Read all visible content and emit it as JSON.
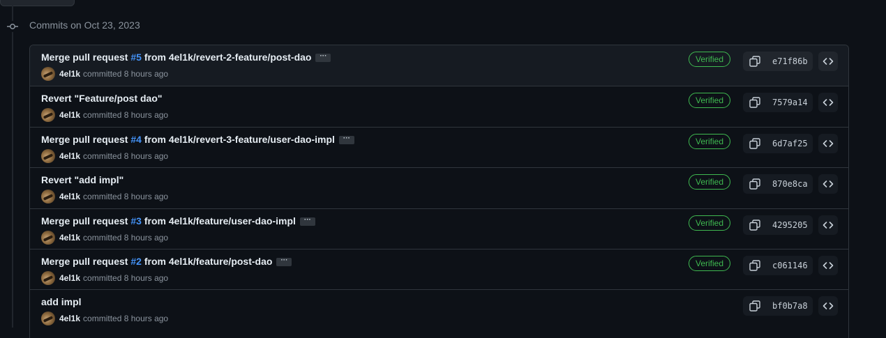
{
  "group": {
    "title": "Commits on Oct 23, 2023"
  },
  "commits": [
    {
      "prefix": "Merge pull request ",
      "pr": "#5",
      "suffix": " from 4el1k/revert-2-feature/post-dao",
      "ellipsis": "···",
      "author": "4el1k",
      "committed": "committed 8 hours ago",
      "verified": "Verified",
      "sha": "e71f86b"
    },
    {
      "prefix": "Revert \"Feature/post dao\"",
      "pr": "",
      "suffix": "",
      "ellipsis": "",
      "author": "4el1k",
      "committed": "committed 8 hours ago",
      "verified": "Verified",
      "sha": "7579a14"
    },
    {
      "prefix": "Merge pull request ",
      "pr": "#4",
      "suffix": " from 4el1k/revert-3-feature/user-dao-impl",
      "ellipsis": "···",
      "author": "4el1k",
      "committed": "committed 8 hours ago",
      "verified": "Verified",
      "sha": "6d7af25"
    },
    {
      "prefix": "Revert \"add impl\"",
      "pr": "",
      "suffix": "",
      "ellipsis": "",
      "author": "4el1k",
      "committed": "committed 8 hours ago",
      "verified": "Verified",
      "sha": "870e8ca"
    },
    {
      "prefix": "Merge pull request ",
      "pr": "#3",
      "suffix": " from 4el1k/feature/user-dao-impl",
      "ellipsis": "···",
      "author": "4el1k",
      "committed": "committed 8 hours ago",
      "verified": "Verified",
      "sha": "4295205"
    },
    {
      "prefix": "Merge pull request ",
      "pr": "#2",
      "suffix": " from 4el1k/feature/post-dao",
      "ellipsis": "···",
      "author": "4el1k",
      "committed": "committed 8 hours ago",
      "verified": "Verified",
      "sha": "c061146"
    },
    {
      "prefix": "add impl",
      "pr": "",
      "suffix": "",
      "ellipsis": "",
      "author": "4el1k",
      "committed": "committed 8 hours ago",
      "verified": "",
      "sha": "bf0b7a8"
    }
  ],
  "colors": {
    "link": "#4493f8",
    "verified": "#3fb950",
    "background": "#0d1117",
    "border": "#30363d"
  },
  "icons": {
    "timeline": "git-commit-icon",
    "copy": "copy-icon",
    "browse": "code-icon"
  }
}
